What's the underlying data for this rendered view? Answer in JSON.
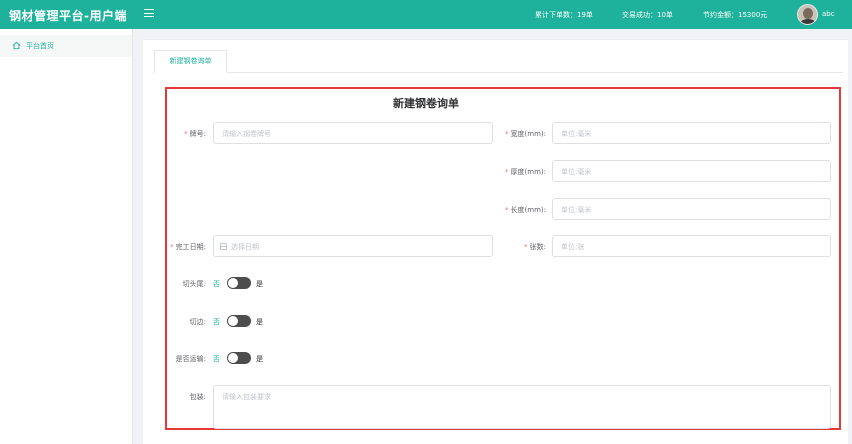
{
  "header": {
    "brand": "钢材管理平台-用户端",
    "stats": [
      {
        "text": "累计下单数：19单"
      },
      {
        "text": "交易成功：10单"
      },
      {
        "text": "节约金额：15300元"
      }
    ],
    "username": "abc"
  },
  "sidebar": {
    "items": [
      {
        "label": "平台首页",
        "icon": "home-icon"
      }
    ]
  },
  "tabs": [
    {
      "label": "新建钢卷询单",
      "active": true
    }
  ],
  "form": {
    "title": "新建钢卷询单",
    "brand_no": {
      "label": "牌号:",
      "placeholder": "请输入钢卷牌号",
      "required": true
    },
    "width": {
      "label": "宽度(mm):",
      "placeholder": "单位:毫米",
      "required": true
    },
    "thickness": {
      "label": "厚度(mm):",
      "placeholder": "单位:毫米",
      "required": true
    },
    "length": {
      "label": "长度(mm):",
      "placeholder": "单位:毫米",
      "required": true
    },
    "finish_date": {
      "label": "完工日期:",
      "placeholder": "选择日期",
      "required": true
    },
    "sheets": {
      "label": "张数:",
      "placeholder": "单位:张",
      "required": true
    },
    "cut_head": {
      "label": "切头尾:",
      "off": "否",
      "on": "是",
      "value": false
    },
    "trim_edge": {
      "label": "切边:",
      "off": "否",
      "on": "是",
      "value": false
    },
    "transport": {
      "label": "是否运输:",
      "off": "否",
      "on": "是",
      "value": false
    },
    "packaging": {
      "label": "包装:",
      "placeholder": "请输入包装要求"
    }
  },
  "colors": {
    "primary": "#1eb29c",
    "required": "#f56c6c",
    "highlight_border": "#e53935"
  }
}
